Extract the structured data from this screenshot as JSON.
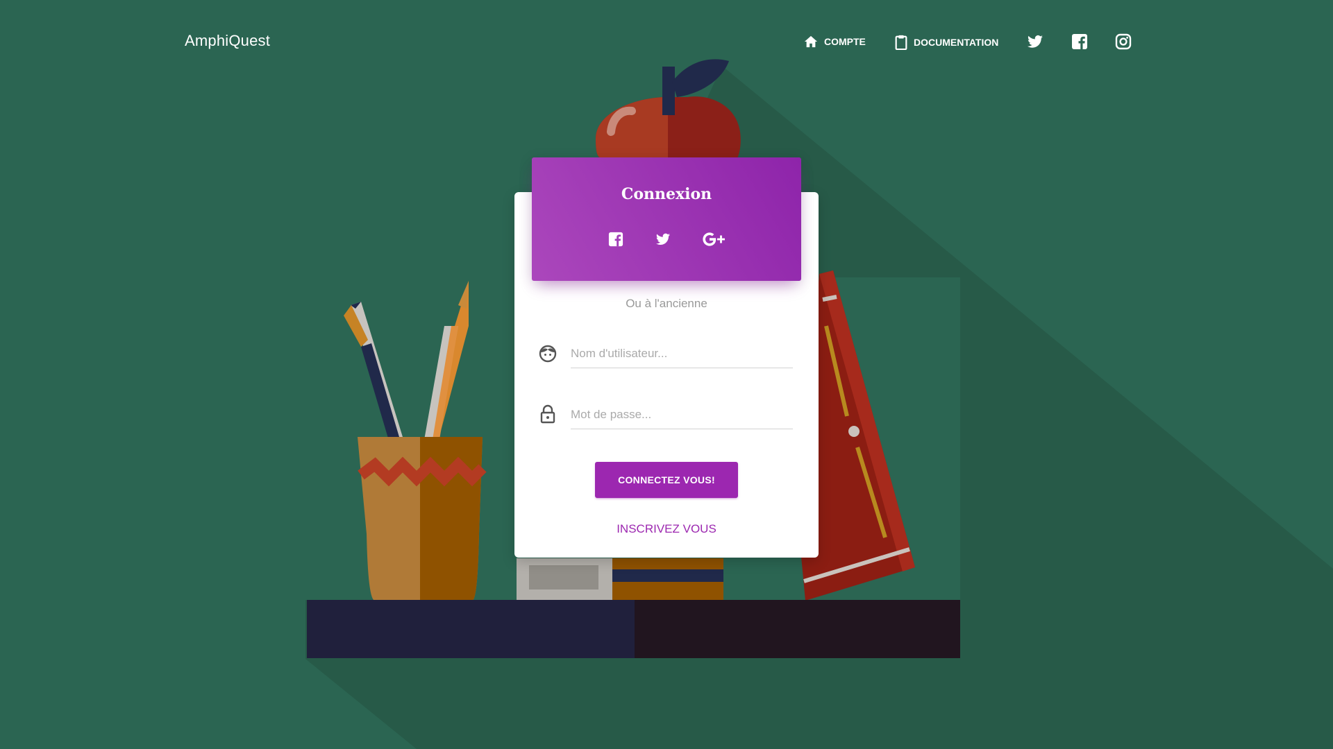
{
  "brand": "AmphiQuest",
  "nav": {
    "account_label": "COMPTE",
    "docs_label": "DOCUMENTATION",
    "social_icons": [
      "twitter-icon",
      "facebook-icon",
      "instagram-icon"
    ]
  },
  "login": {
    "title": "Connexion",
    "social_buttons": [
      "facebook-icon",
      "twitter-icon",
      "google-plus-icon"
    ],
    "subtitle": "Ou à l'ancienne",
    "username_placeholder": "Nom d'utilisateur...",
    "password_placeholder": "Mot de passe...",
    "submit_label": "CONNECTEZ VOUS!",
    "register_label": "INSCRIVEZ VOUS"
  },
  "colors": {
    "background": "#2b6552",
    "accent": "#9c27b0",
    "header_gradient_start": "#ab47bc",
    "header_gradient_end": "#8e24aa"
  }
}
